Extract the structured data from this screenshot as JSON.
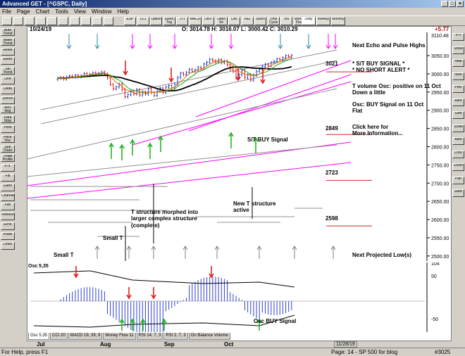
{
  "window": {
    "title": "Advanced GET - [^GSPC, Daily]"
  },
  "menu": [
    "File",
    "Page",
    "Chart",
    "Tools",
    "View",
    "Window",
    "Help"
  ],
  "toolbar": {
    "buttons": [
      "ESP",
      "CCI",
      "Option",
      "Elliott Trig",
      "JTI",
      "MACD",
      "OBV",
      "Open Int",
      "Osc",
      "REI",
      "Stoch",
      "Time Cycle",
      "Vol",
      "Money Flow"
    ],
    "periods": [
      "Daily",
      "Weekly",
      "Monthly"
    ]
  },
  "left_tools": [
    "Auto Trend",
    "Make Trend",
    "Reset",
    "Elliott",
    "Sel Trend",
    "Line",
    "Delta",
    "Donch",
    "Mov Avg",
    "Para Stop",
    "Pivot",
    "Price Osc",
    "Sep Chart",
    "Trade Profile",
    "XTL",
    "Fib",
    "Gann",
    "Channel",
    "Fan",
    "Retrace",
    "Echo",
    "Pulse",
    "Lines"
  ],
  "right_tools": [
    "PTI",
    "Show",
    "Hide",
    "Next",
    "Prev",
    "Alert",
    "Grid",
    "Scale",
    "Auto",
    "Lock",
    "Zoom",
    "Pan",
    "Save"
  ],
  "chart": {
    "date": "10/24/19",
    "ohlc": "O: 3014.78  H: 3016.07  L: 3000.42  C: 3010.29",
    "change": "+5.77",
    "price_top_label": "3110.48",
    "price_ticks": [
      "3050.00",
      "3000.00",
      "2950.00",
      "2900.00",
      "2850.00",
      "2800.00",
      "2750.00",
      "2700.00",
      "2650.00",
      "2600.00",
      "2550.00",
      "2500.00"
    ],
    "levels": [
      "3021",
      "2849",
      "2723",
      "2598"
    ]
  },
  "annotations": {
    "echo": "Next Echo and Pulse Highs",
    "st_buy": "* S/T BUY SIGNAL *",
    "no_short": "* NO SHORT ALERT *",
    "tvol1": "T volume Osc: positive on 11 Oct",
    "tvol2": "Down a little",
    "osc1": "Osc: BUY Signal on 11 Oct",
    "osc2": "Flat",
    "click1": "Click here for",
    "click2": "More Information...",
    "st_buy_signal": "S/T BUY Signal",
    "t_struct1": "T structure morphed into",
    "t_struct2": "larger complex structure",
    "t_struct3": "(complete)",
    "new_t1": "New T structure",
    "new_t2": "active",
    "small_t1": "Small T",
    "small_t2": "Small T",
    "next_low": "Next Projected Low(s)"
  },
  "osc": {
    "label": "Osc 5,35",
    "tick_top": "104",
    "tick_mid": "50",
    "tick_bottom": "-50",
    "buy_label": "Osc BUY Signal"
  },
  "tabs": [
    "Osc 5,35",
    "CCI 20",
    "MACD 19, 39, 9",
    "Money Flow 11",
    "RSI 14, 7, 3",
    "RSI 2, 7, 3",
    "On Balance Volume"
  ],
  "xaxis": {
    "labels": [
      "Jul",
      "Aug",
      "Sep",
      "Oct"
    ],
    "end_date": "11/28/19"
  },
  "status": {
    "help": "For Help, press F1",
    "page": "Page: 14 - SP 500 for blog",
    "record": "#3025"
  },
  "colors": {
    "up_bar": "#1a3cc8",
    "down_bar": "#e01010",
    "arrow_up": "#16b016",
    "arrow_down": "#e01010",
    "osc_bar": "#3040d0",
    "magenta": "#ff00ff"
  }
}
